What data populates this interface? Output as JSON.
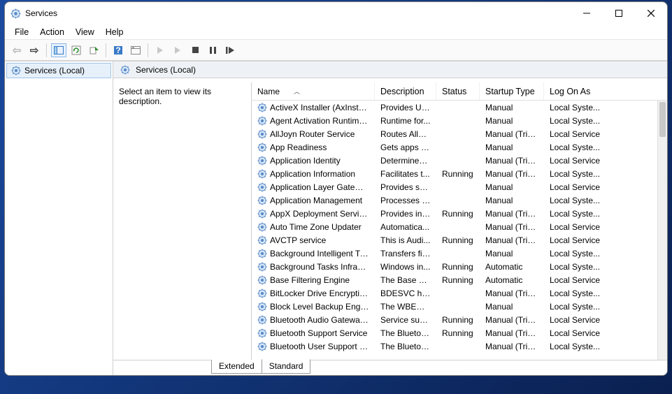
{
  "window": {
    "title": "Services"
  },
  "menubar": {
    "file": "File",
    "action": "Action",
    "view": "View",
    "help": "Help"
  },
  "tree": {
    "root": "Services (Local)"
  },
  "right_header": "Services (Local)",
  "detail_prompt": "Select an item to view its description.",
  "columns": {
    "name": "Name",
    "description": "Description",
    "status": "Status",
    "startup": "Startup Type",
    "logon": "Log On As"
  },
  "tabs": {
    "extended": "Extended",
    "standard": "Standard"
  },
  "services": [
    {
      "name": "ActiveX Installer (AxInstSV)",
      "desc": "Provides Us...",
      "status": "",
      "startup": "Manual",
      "logon": "Local Syste..."
    },
    {
      "name": "Agent Activation Runtime_...",
      "desc": "Runtime for...",
      "status": "",
      "startup": "Manual",
      "logon": "Local Syste..."
    },
    {
      "name": "AllJoyn Router Service",
      "desc": "Routes AllJo...",
      "status": "",
      "startup": "Manual (Trig...",
      "logon": "Local Service"
    },
    {
      "name": "App Readiness",
      "desc": "Gets apps re...",
      "status": "",
      "startup": "Manual",
      "logon": "Local Syste..."
    },
    {
      "name": "Application Identity",
      "desc": "Determines ...",
      "status": "",
      "startup": "Manual (Trig...",
      "logon": "Local Service"
    },
    {
      "name": "Application Information",
      "desc": "Facilitates t...",
      "status": "Running",
      "startup": "Manual (Trig...",
      "logon": "Local Syste..."
    },
    {
      "name": "Application Layer Gateway ...",
      "desc": "Provides su...",
      "status": "",
      "startup": "Manual",
      "logon": "Local Service"
    },
    {
      "name": "Application Management",
      "desc": "Processes in...",
      "status": "",
      "startup": "Manual",
      "logon": "Local Syste..."
    },
    {
      "name": "AppX Deployment Service (...",
      "desc": "Provides inf...",
      "status": "Running",
      "startup": "Manual (Trig...",
      "logon": "Local Syste..."
    },
    {
      "name": "Auto Time Zone Updater",
      "desc": "Automatica...",
      "status": "",
      "startup": "Manual (Trig...",
      "logon": "Local Service"
    },
    {
      "name": "AVCTP service",
      "desc": "This is Audi...",
      "status": "Running",
      "startup": "Manual (Trig...",
      "logon": "Local Service"
    },
    {
      "name": "Background Intelligent Tran...",
      "desc": "Transfers fil...",
      "status": "",
      "startup": "Manual",
      "logon": "Local Syste..."
    },
    {
      "name": "Background Tasks Infrastruc...",
      "desc": "Windows in...",
      "status": "Running",
      "startup": "Automatic",
      "logon": "Local Syste..."
    },
    {
      "name": "Base Filtering Engine",
      "desc": "The Base Fil...",
      "status": "Running",
      "startup": "Automatic",
      "logon": "Local Service"
    },
    {
      "name": "BitLocker Drive Encryption ...",
      "desc": "BDESVC hos...",
      "status": "",
      "startup": "Manual (Trig...",
      "logon": "Local Syste..."
    },
    {
      "name": "Block Level Backup Engine ...",
      "desc": "The WBENG...",
      "status": "",
      "startup": "Manual",
      "logon": "Local Syste..."
    },
    {
      "name": "Bluetooth Audio Gateway S...",
      "desc": "Service sup...",
      "status": "Running",
      "startup": "Manual (Trig...",
      "logon": "Local Service"
    },
    {
      "name": "Bluetooth Support Service",
      "desc": "The Bluetoo...",
      "status": "Running",
      "startup": "Manual (Trig...",
      "logon": "Local Service"
    },
    {
      "name": "Bluetooth User Support Ser...",
      "desc": "The Bluetoo...",
      "status": "",
      "startup": "Manual (Trig...",
      "logon": "Local Syste..."
    }
  ]
}
